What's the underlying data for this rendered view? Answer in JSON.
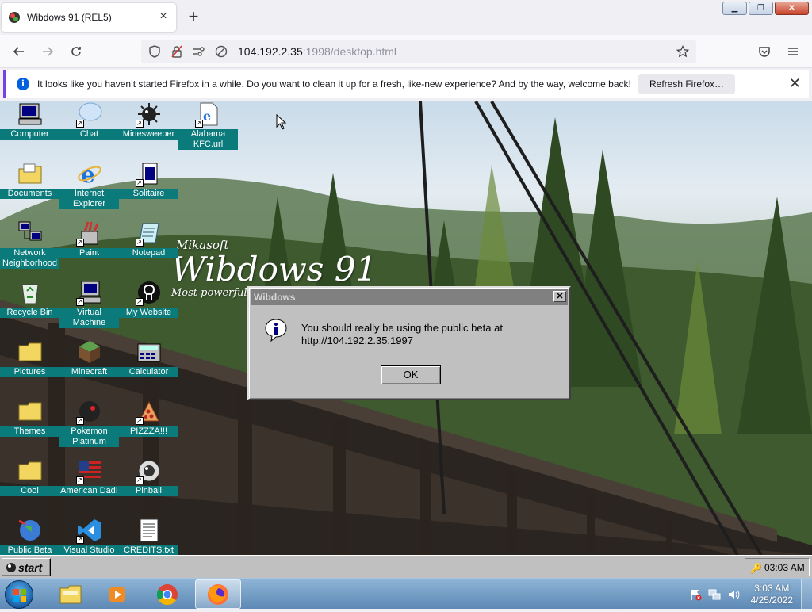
{
  "browser": {
    "tab_title": "Wibdows 91 (REL5)",
    "url_host": "104.192.2.35",
    "url_rest": ":1998/desktop.html",
    "notice_text": "It looks like you haven’t started Firefox in a while. Do you want to clean it up for a fresh, like-new experience? And by the way, welcome back!",
    "notice_button": "Refresh Firefox…",
    "icons": {
      "back": "back-arrow-icon",
      "forward": "forward-arrow-icon",
      "reload": "reload-icon",
      "shield": "tracking-shield-icon",
      "bookmark": "star-icon",
      "pocket": "pocket-icon",
      "menu": "hamburger-menu-icon"
    }
  },
  "desktop": {
    "brand_small": "Mikasoft",
    "brand_big": "Wibdows 91",
    "brand_tag": "Most powerful P",
    "icons": [
      {
        "label": "Computer",
        "icon": "computer-icon"
      },
      {
        "label": "Chat",
        "icon": "chat-bubble-icon"
      },
      {
        "label": "Minesweeper",
        "icon": "minesweeper-icon"
      },
      {
        "label": "Alabama KFC.url",
        "icon": "internet-shortcut-icon"
      },
      {
        "label": "Documents",
        "icon": "documents-folder-icon"
      },
      {
        "label": "Internet Explorer",
        "icon": "internet-explorer-icon"
      },
      {
        "label": "Solitaire",
        "icon": "solitaire-icon"
      },
      {
        "label": "Network Neighborhood",
        "icon": "network-icon"
      },
      {
        "label": "Paint",
        "icon": "paint-icon"
      },
      {
        "label": "Notepad",
        "icon": "notepad-icon"
      },
      {
        "label": "Recycle Bin",
        "icon": "recycle-bin-icon"
      },
      {
        "label": "Virtual Machine",
        "icon": "virtual-machine-icon"
      },
      {
        "label": "My Website",
        "icon": "github-icon"
      },
      {
        "label": "Pictures",
        "icon": "folder-icon"
      },
      {
        "label": "Minecraft",
        "icon": "minecraft-icon"
      },
      {
        "label": "Calculator",
        "icon": "calculator-icon"
      },
      {
        "label": "Themes",
        "icon": "folder-icon"
      },
      {
        "label": "Pokemon Platinum",
        "icon": "pokemon-icon"
      },
      {
        "label": "PIZZZA!!!",
        "icon": "pizza-icon"
      },
      {
        "label": "Cool",
        "icon": "folder-icon"
      },
      {
        "label": "American Dad!",
        "icon": "us-flag-icon"
      },
      {
        "label": "Pinball",
        "icon": "pinball-icon"
      },
      {
        "label": "Public Beta",
        "icon": "globe-icon"
      },
      {
        "label": "Visual Studio",
        "icon": "visual-studio-icon"
      },
      {
        "label": "CREDITS.txt",
        "icon": "text-file-icon"
      }
    ]
  },
  "dialog": {
    "title": "Wibdows",
    "line1": "You should really be using the public beta at",
    "line2": "http://104.192.2.35:1997",
    "ok": "OK"
  },
  "wibdows_taskbar": {
    "start": "start",
    "clock": "03:03 AM"
  },
  "os_taskbar": {
    "apps": [
      "file-explorer-icon",
      "media-player-icon",
      "chrome-icon",
      "firefox-icon"
    ],
    "time": "3:03 AM",
    "date": "4/25/2022"
  }
}
